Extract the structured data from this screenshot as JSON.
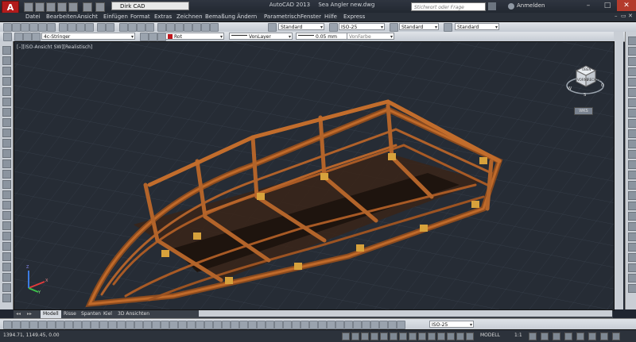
{
  "title_bar": {
    "logo": "A",
    "workspace": "Dirk CAD",
    "app_title": "AutoCAD 2013",
    "file_name": "Sea Angler new.dwg",
    "search_placeholder": "Stichwort oder Frage eingeben",
    "login_label": "Anmelden"
  },
  "menu": [
    "Datei",
    "Bearbeiten",
    "Ansicht",
    "Einfügen",
    "Format",
    "Extras",
    "Zeichnen",
    "Bemaßung",
    "Ändern",
    "Parametrisch",
    "Fenster",
    "Hilfe",
    "Express"
  ],
  "toolbar1": {
    "text_style": "Standard",
    "dim_style": "ISO-25",
    "table_style": "Standard",
    "multileader_style": "Standard"
  },
  "toolbar2": {
    "layer": "4c-Stringer",
    "color": "Rot",
    "color_hex": "#c0151c",
    "linetype": "VonLayer",
    "lineweight": "0.05 mm",
    "plotstyle": "VonFarbe"
  },
  "viewport": {
    "label": "[–][ISO-Ansicht SW][Realistisch]",
    "viewcube_faces": [
      "OBEN",
      "VORNE",
      "RECHTS"
    ],
    "compass": [
      "S",
      "W",
      "O"
    ],
    "wcs_label": "WKS",
    "ucs_axes": [
      "X",
      "Y",
      "Z"
    ]
  },
  "tabs": [
    "Modell",
    "Risse",
    "Spanten",
    "Kiel",
    "3D Ansichten"
  ],
  "bottom_toolbar": {
    "dim_style": "ISO-25"
  },
  "status": {
    "coords": "1394.71, 1149.45, 0.00",
    "space": "MODELL",
    "scale": "1:1"
  }
}
